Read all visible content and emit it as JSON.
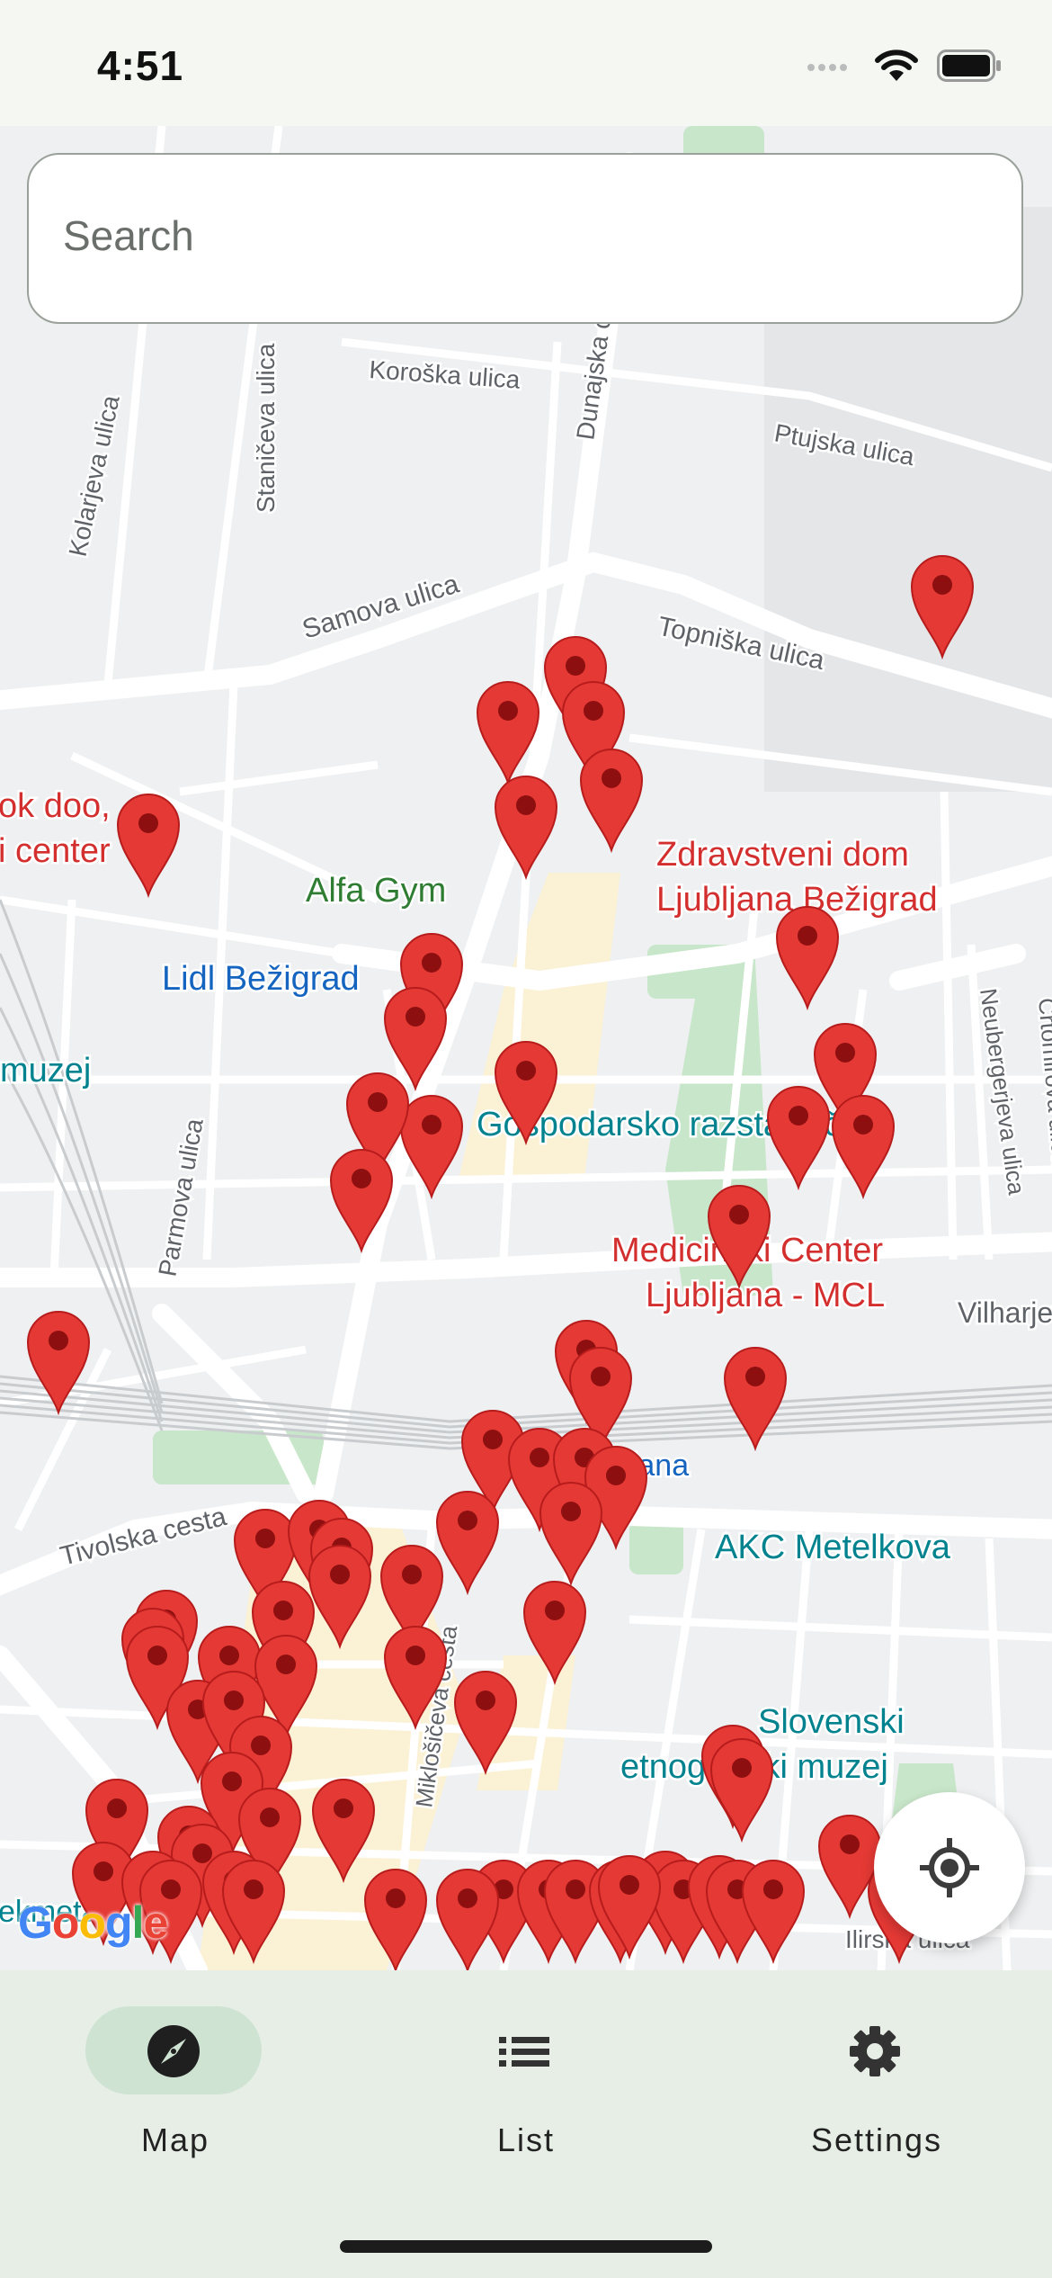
{
  "status_bar": {
    "time": "4:51"
  },
  "search": {
    "placeholder": "Search"
  },
  "map": {
    "streets": [
      "Koroška ulica",
      "Ptujska ulica",
      "Dunajska c.",
      "Staničeva ulica",
      "Kolarjeva ulica",
      "Samova ulica",
      "Topniška ulica",
      "Neubergerjeva ulica",
      "Črtomirova ulica",
      "Parmova ulica",
      "Tivolska cesta",
      "Vilharjeva",
      "Miklošičeva cesta",
      "Ilirska ulica"
    ],
    "places": [
      "ok doo,",
      "i center",
      "Zdravstveni dom",
      "Ljubljana Bežigrad",
      "Alfa Gym",
      "Lidl Bežigrad",
      "muzej",
      "Gospodarsko razstavišče",
      "Medicinski Center",
      "Ljubljana - MCL",
      "Ljubljana",
      "AKC Metelkova",
      "Slovenski",
      "etnografski muzej",
      "ekmetal"
    ],
    "attribution": "Google",
    "colors": {
      "pin": "#e53935",
      "pin_dot": "#8e0f0f",
      "green_label": "#2e7d32",
      "blue_label": "#1565c0",
      "teal_label": "#00838f",
      "red_label": "#d32f2f"
    }
  },
  "locate_button": {
    "icon": "my-location-icon"
  },
  "bottom_nav": {
    "items": [
      {
        "label": "Map",
        "icon": "compass-icon",
        "active": true
      },
      {
        "label": "List",
        "icon": "list-icon",
        "active": false
      },
      {
        "label": "Settings",
        "icon": "gear-icon",
        "active": false
      }
    ]
  }
}
